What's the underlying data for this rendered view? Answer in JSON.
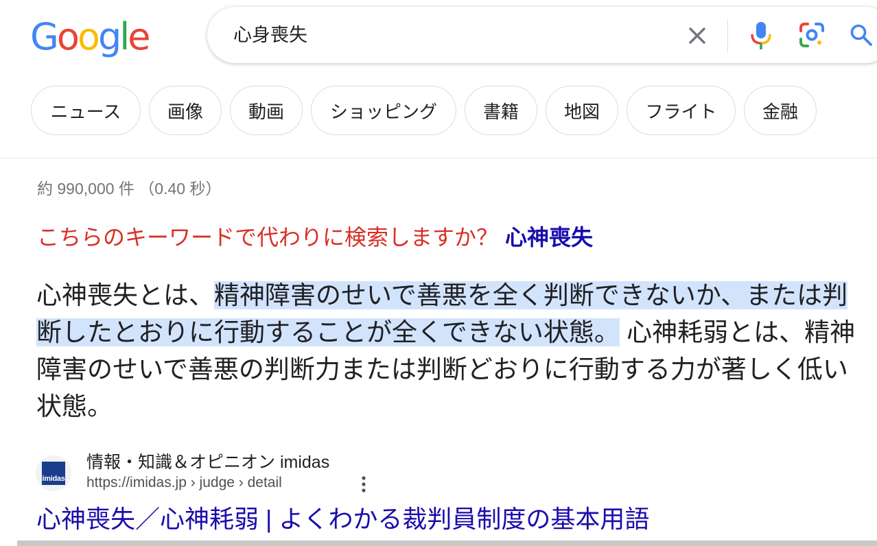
{
  "logo": {
    "letters": [
      "G",
      "o",
      "o",
      "g",
      "l",
      "e"
    ]
  },
  "search": {
    "query": "心身喪失"
  },
  "chips": [
    "ニュース",
    "画像",
    "動画",
    "ショッピング",
    "書籍",
    "地図",
    "フライト",
    "金融"
  ],
  "stats": "約 990,000 件 （0.40 秒）",
  "did_you_mean": {
    "prefix": "こちらのキーワードで代わりに検索しますか？",
    "link": "心神喪失"
  },
  "snippet": {
    "before": "心神喪失とは、",
    "highlighted": "精神障害のせいで善悪を全く判断できないか、または判断したとおりに行動することが全くできない状態。",
    "after": " 心神耗弱とは、精神障害のせいで善悪の判断力または判断どおりに行動する力が著しく低い状態。"
  },
  "result": {
    "favicon_text": "imidas",
    "site_name": "情報・知識＆オピニオン imidas",
    "url": "https://imidas.jp › judge › detail",
    "title": "心神喪失／心神耗弱 | よくわかる裁判員制度の基本用語"
  },
  "colors": {
    "link": "#1a0dab",
    "did_you_mean": "#d93025",
    "highlight": "#d2e3fc"
  }
}
